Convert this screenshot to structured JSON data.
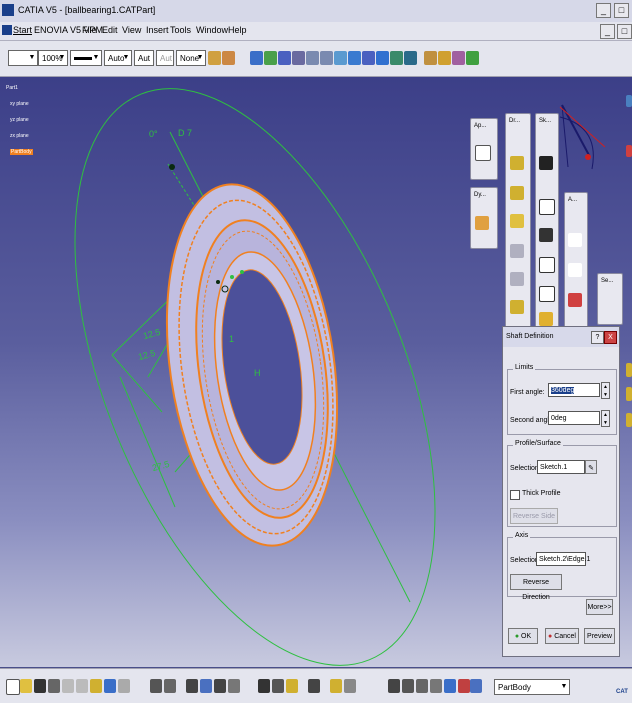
{
  "window": {
    "title": "CATIA V5 - [ballbearing1.CATPart]",
    "minimize": "_",
    "maximize": "□",
    "close": "x"
  },
  "menu": {
    "items": [
      "Start",
      "ENOVIA V5 VPM",
      "File",
      "Edit",
      "View",
      "Insert",
      "Tools",
      "Window",
      "Help"
    ]
  },
  "toolbar": {
    "zoom": "100%",
    "linetype": "Auto",
    "weight": "Aut",
    "weight2": "Aut",
    "layer": "None"
  },
  "tree": {
    "root": "Part1",
    "xy": "xy plane",
    "yz": "yz plane",
    "zx": "zx plane",
    "body": "PartBody"
  },
  "palettes": {
    "ap": "Ap...",
    "dy": "Dy...",
    "dr": "Dr...",
    "sk": "Sk...",
    "a": "A...",
    "se": "Se..."
  },
  "dims": {
    "d7": "D 7",
    "zero": "0°",
    "r125a": "12.5",
    "r125b": "12.5",
    "r275": "27.5",
    "r1": "1",
    "h": "H"
  },
  "dialog": {
    "title": "Shaft Definition",
    "help": "?",
    "close": "X",
    "limits": "Limits",
    "first_angle_label": "First angle:",
    "first_angle_value": "360deg",
    "second_angle_label": "Second angle:",
    "second_angle_value": "0deg",
    "profile_group": "Profile/Surface",
    "selection_label": "Selection:",
    "profile_selection": "Sketch.1",
    "thick_profile": "Thick Profile",
    "reverse_side": "Reverse Side",
    "axis_group": "Axis",
    "axis_selection_label": "Selection:",
    "axis_selection": "Sketch.2\\Edge.1",
    "reverse_direction": "Reverse Direction",
    "more": "More>>",
    "ok": "OK",
    "cancel": "Cancel",
    "preview": "Preview"
  },
  "status": {
    "body_combo": "PartBody",
    "logo": "CAT"
  },
  "colors": {
    "viewport_top": "#3c3f88",
    "viewport_bottom": "#c8cadf",
    "highlight_orange": "#f08020",
    "wire_green": "#2ec040",
    "part_face": "#c2bfe2"
  }
}
